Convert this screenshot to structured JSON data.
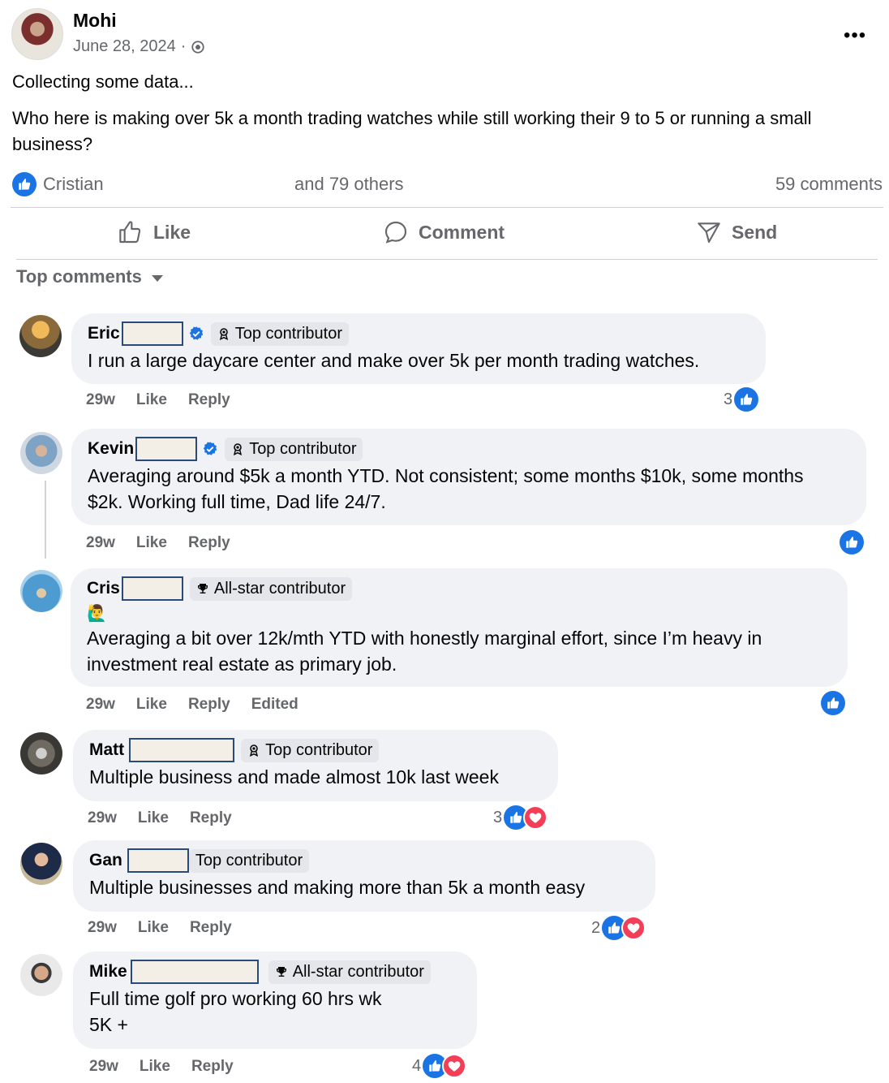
{
  "post": {
    "author": "Mohi",
    "date": "June 28, 2024",
    "dot": "·",
    "text1": "Collecting some data...",
    "text2": "Who here is making over 5k a month trading watches while still working their 9 to 5 or running a small business?",
    "reactor": "Cristian",
    "others": "and 79 others",
    "comments_count": "59 comments"
  },
  "actions": {
    "like": "Like",
    "comment": "Comment",
    "send": "Send"
  },
  "top_comments_label": "Top comments",
  "comments": [
    {
      "name": "Eric",
      "badge": "Top contributor",
      "text": "I run a large daycare center and make over 5k per month trading watches.",
      "time": "29w",
      "like": "Like",
      "reply": "Reply",
      "count": "3"
    },
    {
      "name": "Kevin",
      "badge": "Top contributor",
      "text": "Averaging around $5k a month YTD. Not consistent; some months $10k, some months $2k. Working full time, Dad life 24/7.",
      "time": "29w",
      "like": "Like",
      "reply": "Reply"
    },
    {
      "name": "Cris",
      "badge": "All-star contributor",
      "emoji": "🙋‍♂️",
      "text": "Averaging a bit over 12k/mth YTD with honestly marginal effort, since I’m heavy in investment real estate as primary job.",
      "time": "29w",
      "like": "Like",
      "reply": "Reply",
      "edited": "Edited"
    },
    {
      "name": "Matt",
      "badge": "Top contributor",
      "text": "Multiple business and made almost 10k last week",
      "time": "29w",
      "like": "Like",
      "reply": "Reply",
      "count": "3"
    },
    {
      "name": "Gan",
      "badge": "Top contributor",
      "text": "Multiple businesses and making more than 5k a month easy",
      "time": "29w",
      "like": "Like",
      "reply": "Reply",
      "count": "2"
    },
    {
      "name": "Mike",
      "badge": "All-star contributor",
      "text_line1": "Full time golf pro working 60 hrs wk",
      "text_line2": "5K +",
      "time": "29w",
      "like": "Like",
      "reply": "Reply",
      "count": "4"
    }
  ],
  "colors": {
    "accent": "#1b74e4",
    "heart": "#f33e58",
    "muted": "#65676b",
    "bubble": "#f0f2f5"
  }
}
